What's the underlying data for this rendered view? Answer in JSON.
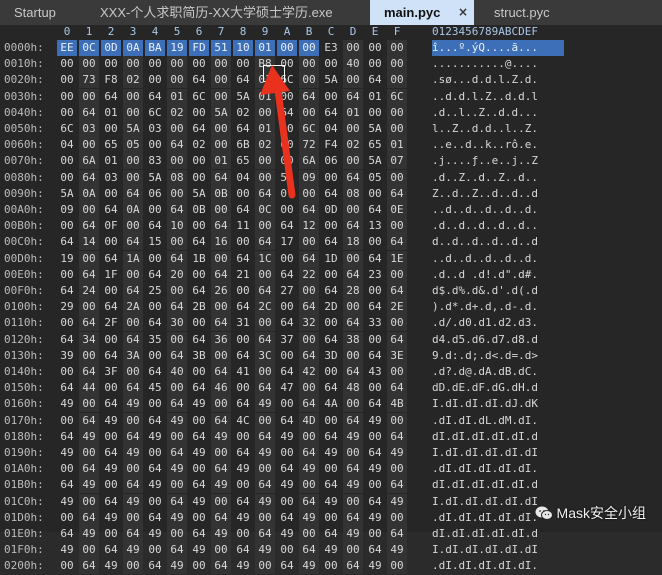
{
  "tabs": [
    {
      "label": "Startup",
      "active": false
    },
    {
      "label": "XXX-个人求职简历-XX大学硕士学历.exe",
      "active": false
    },
    {
      "label": "main.pyc",
      "active": true,
      "close": "×"
    },
    {
      "label": "struct.pyc",
      "active": false
    }
  ],
  "hex": {
    "column_headers": [
      "0",
      "1",
      "2",
      "3",
      "4",
      "5",
      "6",
      "7",
      "8",
      "9",
      "A",
      "B",
      "C",
      "D",
      "E",
      "F"
    ],
    "ascii_header": "0123456789ABCDEF",
    "selection_color": "#3d6fb8",
    "rows": [
      {
        "addr": "0000h:",
        "bytes": [
          "EE",
          "0C",
          "0D",
          "0A",
          "BA",
          "19",
          "FD",
          "51",
          "10",
          "01",
          "00",
          "00",
          "E3",
          "00",
          "00",
          "00"
        ],
        "ascii": "î...º.ýQ....ã..."
      },
      {
        "addr": "0010h:",
        "bytes": [
          "00",
          "00",
          "00",
          "00",
          "00",
          "00",
          "00",
          "00",
          "00",
          "B8",
          "00",
          "00",
          "00",
          "40",
          "00",
          "00"
        ],
        "ascii": "...........@...."
      },
      {
        "addr": "0020h:",
        "bytes": [
          "00",
          "73",
          "F8",
          "02",
          "00",
          "00",
          "64",
          "00",
          "64",
          "01",
          "6C",
          "00",
          "5A",
          "00",
          "64",
          "00"
        ],
        "ascii": ".sø...d.d.l.Z.d."
      },
      {
        "addr": "0030h:",
        "bytes": [
          "00",
          "00",
          "64",
          "00",
          "64",
          "01",
          "6C",
          "00",
          "5A",
          "01",
          "00",
          "64",
          "00",
          "64",
          "01",
          "6C"
        ],
        "ascii": "..d.d.l.Z..d.d.l"
      },
      {
        "addr": "0040h:",
        "bytes": [
          "00",
          "64",
          "01",
          "00",
          "6C",
          "02",
          "00",
          "5A",
          "02",
          "00",
          "64",
          "00",
          "64",
          "01",
          "00",
          "00"
        ],
        "ascii": ".d..l..Z..d.d..."
      },
      {
        "addr": "0050h:",
        "bytes": [
          "6C",
          "03",
          "00",
          "5A",
          "03",
          "00",
          "64",
          "00",
          "64",
          "01",
          "00",
          "6C",
          "04",
          "00",
          "5A",
          "00"
        ],
        "ascii": "l..Z..d.d..l..Z."
      },
      {
        "addr": "0060h:",
        "bytes": [
          "04",
          "00",
          "65",
          "05",
          "00",
          "64",
          "02",
          "00",
          "6B",
          "02",
          "00",
          "72",
          "F4",
          "02",
          "65",
          "01"
        ],
        "ascii": "..e..d..k..rô.e."
      },
      {
        "addr": "0070h:",
        "bytes": [
          "00",
          "6A",
          "01",
          "00",
          "83",
          "00",
          "00",
          "01",
          "65",
          "00",
          "00",
          "6A",
          "06",
          "00",
          "5A",
          "07"
        ],
        "ascii": ".j....ƒ..e..j..Z"
      },
      {
        "addr": "0080h:",
        "bytes": [
          "00",
          "64",
          "03",
          "00",
          "5A",
          "08",
          "00",
          "64",
          "04",
          "00",
          "5A",
          "09",
          "00",
          "64",
          "05",
          "00"
        ],
        "ascii": ".d..Z..d..Z..d.."
      },
      {
        "addr": "0090h:",
        "bytes": [
          "5A",
          "0A",
          "00",
          "64",
          "06",
          "00",
          "5A",
          "0B",
          "00",
          "64",
          "07",
          "00",
          "64",
          "08",
          "00",
          "64"
        ],
        "ascii": "Z..d..Z..d..d..d"
      },
      {
        "addr": "00A0h:",
        "bytes": [
          "09",
          "00",
          "64",
          "0A",
          "00",
          "64",
          "0B",
          "00",
          "64",
          "0C",
          "00",
          "64",
          "0D",
          "00",
          "64",
          "0E"
        ],
        "ascii": "..d..d..d..d..d."
      },
      {
        "addr": "00B0h:",
        "bytes": [
          "00",
          "64",
          "0F",
          "00",
          "64",
          "10",
          "00",
          "64",
          "11",
          "00",
          "64",
          "12",
          "00",
          "64",
          "13",
          "00"
        ],
        "ascii": ".d..d..d..d..d.."
      },
      {
        "addr": "00C0h:",
        "bytes": [
          "64",
          "14",
          "00",
          "64",
          "15",
          "00",
          "64",
          "16",
          "00",
          "64",
          "17",
          "00",
          "64",
          "18",
          "00",
          "64"
        ],
        "ascii": "d..d..d..d..d..d"
      },
      {
        "addr": "00D0h:",
        "bytes": [
          "19",
          "00",
          "64",
          "1A",
          "00",
          "64",
          "1B",
          "00",
          "64",
          "1C",
          "00",
          "64",
          "1D",
          "00",
          "64",
          "1E"
        ],
        "ascii": "..d..d..d..d..d."
      },
      {
        "addr": "00E0h:",
        "bytes": [
          "00",
          "64",
          "1F",
          "00",
          "64",
          "20",
          "00",
          "64",
          "21",
          "00",
          "64",
          "22",
          "00",
          "64",
          "23",
          "00"
        ],
        "ascii": ".d..d .d!.d\".d#."
      },
      {
        "addr": "00F0h:",
        "bytes": [
          "64",
          "24",
          "00",
          "64",
          "25",
          "00",
          "64",
          "26",
          "00",
          "64",
          "27",
          "00",
          "64",
          "28",
          "00",
          "64"
        ],
        "ascii": "d$.d%.d&.d'.d(.d"
      },
      {
        "addr": "0100h:",
        "bytes": [
          "29",
          "00",
          "64",
          "2A",
          "00",
          "64",
          "2B",
          "00",
          "64",
          "2C",
          "00",
          "64",
          "2D",
          "00",
          "64",
          "2E"
        ],
        "ascii": ").d*.d+.d,.d-.d."
      },
      {
        "addr": "0110h:",
        "bytes": [
          "00",
          "64",
          "2F",
          "00",
          "64",
          "30",
          "00",
          "64",
          "31",
          "00",
          "64",
          "32",
          "00",
          "64",
          "33",
          "00"
        ],
        "ascii": ".d/.d0.d1.d2.d3."
      },
      {
        "addr": "0120h:",
        "bytes": [
          "64",
          "34",
          "00",
          "64",
          "35",
          "00",
          "64",
          "36",
          "00",
          "64",
          "37",
          "00",
          "64",
          "38",
          "00",
          "64"
        ],
        "ascii": "d4.d5.d6.d7.d8.d"
      },
      {
        "addr": "0130h:",
        "bytes": [
          "39",
          "00",
          "64",
          "3A",
          "00",
          "64",
          "3B",
          "00",
          "64",
          "3C",
          "00",
          "64",
          "3D",
          "00",
          "64",
          "3E"
        ],
        "ascii": "9.d:.d;.d<.d=.d>"
      },
      {
        "addr": "0140h:",
        "bytes": [
          "00",
          "64",
          "3F",
          "00",
          "64",
          "40",
          "00",
          "64",
          "41",
          "00",
          "64",
          "42",
          "00",
          "64",
          "43",
          "00"
        ],
        "ascii": ".d?.d@.dA.dB.dC."
      },
      {
        "addr": "0150h:",
        "bytes": [
          "64",
          "44",
          "00",
          "64",
          "45",
          "00",
          "64",
          "46",
          "00",
          "64",
          "47",
          "00",
          "64",
          "48",
          "00",
          "64"
        ],
        "ascii": "dD.dE.dF.dG.dH.d"
      },
      {
        "addr": "0160h:",
        "bytes": [
          "49",
          "00",
          "64",
          "49",
          "00",
          "64",
          "49",
          "00",
          "64",
          "49",
          "00",
          "64",
          "4A",
          "00",
          "64",
          "4B"
        ],
        "ascii": "I.dI.dI.dI.dJ.dK"
      },
      {
        "addr": "0170h:",
        "bytes": [
          "00",
          "64",
          "49",
          "00",
          "64",
          "49",
          "00",
          "64",
          "4C",
          "00",
          "64",
          "4D",
          "00",
          "64",
          "49",
          "00"
        ],
        "ascii": ".dI.dI.dL.dM.dI."
      },
      {
        "addr": "0180h:",
        "bytes": [
          "64",
          "49",
          "00",
          "64",
          "49",
          "00",
          "64",
          "49",
          "00",
          "64",
          "49",
          "00",
          "64",
          "49",
          "00",
          "64"
        ],
        "ascii": "dI.dI.dI.dI.dI.d"
      },
      {
        "addr": "0190h:",
        "bytes": [
          "49",
          "00",
          "64",
          "49",
          "00",
          "64",
          "49",
          "00",
          "64",
          "49",
          "00",
          "64",
          "49",
          "00",
          "64",
          "49"
        ],
        "ascii": "I.dI.dI.dI.dI.dI"
      },
      {
        "addr": "01A0h:",
        "bytes": [
          "00",
          "64",
          "49",
          "00",
          "64",
          "49",
          "00",
          "64",
          "49",
          "00",
          "64",
          "49",
          "00",
          "64",
          "49",
          "00"
        ],
        "ascii": ".dI.dI.dI.dI.dI."
      },
      {
        "addr": "01B0h:",
        "bytes": [
          "64",
          "49",
          "00",
          "64",
          "49",
          "00",
          "64",
          "49",
          "00",
          "64",
          "49",
          "00",
          "64",
          "49",
          "00",
          "64"
        ],
        "ascii": "dI.dI.dI.dI.dI.d"
      },
      {
        "addr": "01C0h:",
        "bytes": [
          "49",
          "00",
          "64",
          "49",
          "00",
          "64",
          "49",
          "00",
          "64",
          "49",
          "00",
          "64",
          "49",
          "00",
          "64",
          "49"
        ],
        "ascii": "I.dI.dI.dI.dI.dI"
      },
      {
        "addr": "01D0h:",
        "bytes": [
          "00",
          "64",
          "49",
          "00",
          "64",
          "49",
          "00",
          "64",
          "49",
          "00",
          "64",
          "49",
          "00",
          "64",
          "49",
          "00"
        ],
        "ascii": ".dI.dI.dI.dI.dI."
      },
      {
        "addr": "01E0h:",
        "bytes": [
          "64",
          "49",
          "00",
          "64",
          "49",
          "00",
          "64",
          "49",
          "00",
          "64",
          "49",
          "00",
          "64",
          "49",
          "00",
          "64"
        ],
        "ascii": "dI.dI.dI.dI.dI.d"
      },
      {
        "addr": "01F0h:",
        "bytes": [
          "49",
          "00",
          "64",
          "49",
          "00",
          "64",
          "49",
          "00",
          "64",
          "49",
          "00",
          "64",
          "49",
          "00",
          "64",
          "49"
        ],
        "ascii": "I.dI.dI.dI.dI.dI"
      },
      {
        "addr": "0200h:",
        "bytes": [
          "00",
          "64",
          "49",
          "00",
          "64",
          "49",
          "00",
          "64",
          "49",
          "00",
          "64",
          "49",
          "00",
          "64",
          "49",
          "00"
        ],
        "ascii": ".dI.dI.dI.dI.dI."
      }
    ]
  },
  "annotation": {
    "arrow_color": "#e8321e"
  },
  "watermark": {
    "text": "Mask安全小组",
    "icon": "wechat-icon"
  }
}
